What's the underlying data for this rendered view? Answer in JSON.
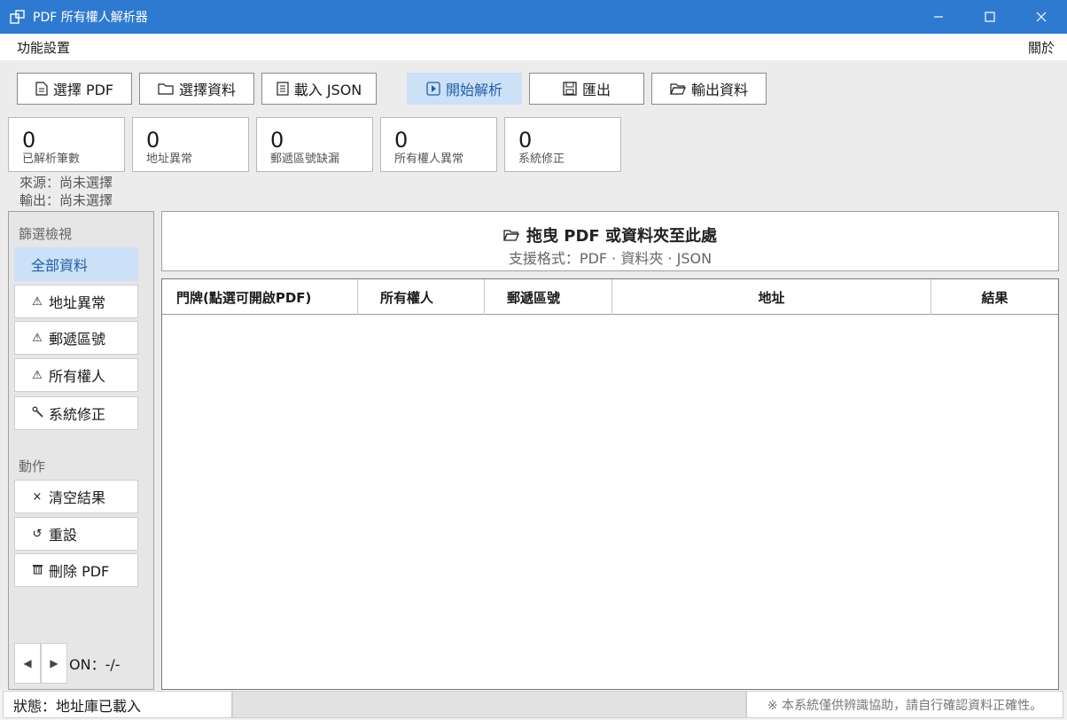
{
  "window": {
    "title": "PDF 所有權人解析器"
  },
  "menu": {
    "left": "功能設置",
    "right": "關於"
  },
  "toolbar": {
    "select_pdf": "選擇 PDF",
    "select_folder": "選擇資料",
    "load_json": "載入 JSON",
    "start": "開始解析",
    "export": "匯出",
    "output_folder": "輸出資料"
  },
  "stats": [
    {
      "value": "0",
      "label": "已解析筆數"
    },
    {
      "value": "0",
      "label": "地址異常"
    },
    {
      "value": "0",
      "label": "郵遞區號缺漏"
    },
    {
      "value": "0",
      "label": "所有權人異常"
    },
    {
      "value": "0",
      "label": "系統修正"
    }
  ],
  "info": {
    "source": "來源：尚未選擇",
    "output": "輸出：尚未選擇"
  },
  "sidebar": {
    "filter_head": "篩選檢視",
    "filters": [
      {
        "label": "全部資料",
        "icon": ""
      },
      {
        "label": "地址異常",
        "icon": "⚠"
      },
      {
        "label": "郵遞區號",
        "icon": "⚠"
      },
      {
        "label": "所有權人",
        "icon": "⚠"
      },
      {
        "label": "系統修正",
        "icon": "wrench-icon"
      }
    ],
    "action_head": "動作",
    "actions": [
      {
        "label": "清空結果",
        "icon": "×"
      },
      {
        "label": "重設",
        "icon": "↺"
      },
      {
        "label": "刪除 PDF",
        "icon": "trash-icon"
      }
    ],
    "pager_text": "ON：-/-"
  },
  "dropzone": {
    "title": "拖曳 PDF 或資料夾至此處",
    "subtitle": "支援格式：PDF · 資料夾 · JSON"
  },
  "table": {
    "columns": [
      "門牌(點選可開啟PDF)",
      "所有權人",
      "郵遞區號",
      "地址",
      "結果"
    ]
  },
  "status": {
    "left": "狀態：地址庫已載入",
    "right": "※ 本系統僅供辨識協助，請自行確認資料正確性。"
  },
  "colors": {
    "titlebar": "#2f7ad1",
    "accent_bg": "#cce0f7",
    "accent_text": "#1f5fa8"
  }
}
